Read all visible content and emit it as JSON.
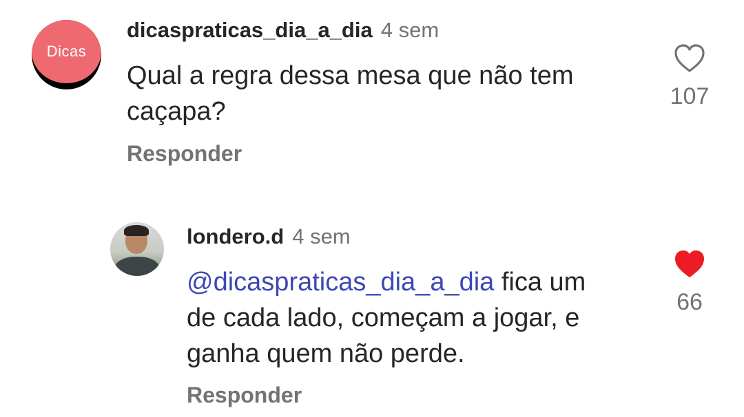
{
  "comments": [
    {
      "username": "dicaspraticas_dia_a_dia",
      "time": "4 sem",
      "avatar_label": "Dicas",
      "text_lines": [
        "Qual a regra dessa mesa que não tem",
        "caçapa?"
      ],
      "reply_label": "Responder",
      "likes": "107",
      "liked": false,
      "avatar_color": "#ee6a70"
    },
    {
      "username": "londero.d",
      "time": "4 sem",
      "mention": "@dicaspraticas_dia_a_dia",
      "text_lines": [
        "fica um",
        "de cada lado, começam a jogar, e",
        "ganha quem não perde."
      ],
      "reply_label": "Responder",
      "likes": "66",
      "liked": true
    }
  ],
  "colors": {
    "mention": "#3d48b5",
    "liked_heart": "#ed1c24",
    "secondary_text": "#737373"
  }
}
